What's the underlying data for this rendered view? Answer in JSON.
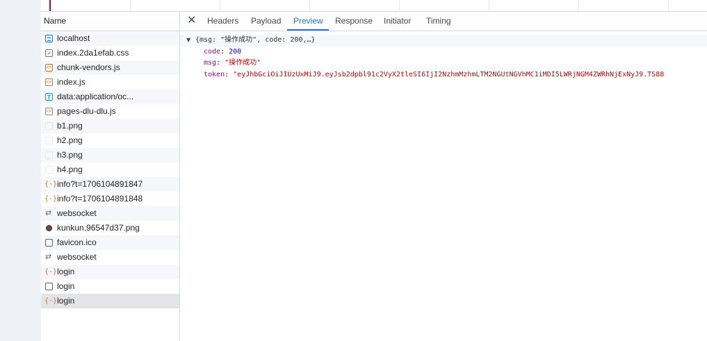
{
  "name_header": "Name",
  "requests": [
    {
      "icon": "document-icon",
      "type": "doc",
      "name": "localhost"
    },
    {
      "icon": "stylesheet-icon",
      "type": "css",
      "name": "index.2da1efab.css"
    },
    {
      "icon": "script-icon",
      "type": "js",
      "name": "chunk-vendors.js"
    },
    {
      "icon": "script-icon",
      "type": "js",
      "name": "index.js"
    },
    {
      "icon": "data-uri-icon",
      "type": "data",
      "name": "data:application/oc..."
    },
    {
      "icon": "script-icon",
      "type": "js",
      "name": "pages-dlu-dlu.js"
    },
    {
      "icon": "image-icon",
      "type": "img",
      "name": "b1.png"
    },
    {
      "icon": "image-icon",
      "type": "img",
      "name": "h2.png"
    },
    {
      "icon": "image-icon",
      "type": "img",
      "name": "h3.png"
    },
    {
      "icon": "image-icon",
      "type": "img",
      "name": "h4.png"
    },
    {
      "icon": "xhr-icon",
      "type": "xhr",
      "name": "info?t=1706104891847"
    },
    {
      "icon": "xhr-icon",
      "type": "xhr",
      "name": "info?t=1706104891848"
    },
    {
      "icon": "websocket-icon",
      "type": "ws",
      "name": "websocket"
    },
    {
      "icon": "image-thumbnail-icon",
      "type": "png",
      "name": "kunkun.96547d37.png"
    },
    {
      "icon": "blank-document-icon",
      "type": "blank",
      "name": "favicon.ico"
    },
    {
      "icon": "websocket-icon",
      "type": "ws",
      "name": "websocket"
    },
    {
      "icon": "xhr-icon",
      "type": "xhr",
      "name": "login"
    },
    {
      "icon": "blank-document-icon",
      "type": "blank",
      "name": "login"
    },
    {
      "icon": "xhr-icon",
      "type": "xhr",
      "name": "login"
    }
  ],
  "selected_index": 18,
  "tabs": [
    "Headers",
    "Payload",
    "Preview",
    "Response",
    "Initiator",
    "Timing"
  ],
  "active_tab": "Preview",
  "preview": {
    "summary": "{msg: \"操作成功\", code: 200,…}",
    "fields": [
      {
        "key": "code",
        "value": "200",
        "kind": "number"
      },
      {
        "key": "msg",
        "value": "\"操作成功\"",
        "kind": "string"
      },
      {
        "key": "token",
        "value": "\"eyJhbGciOiJIUzUxMiJ9.eyJsb2dpbl91c2VyX2tleSI6IjI2NzhmMzhmLTM2NGUtNGVhMC1iMDI5LWRjNGM4ZWRhNjExNyJ9.TS88",
        "kind": "string"
      }
    ]
  },
  "colors": {
    "accent": "#1a73e8",
    "json_key": "#881280",
    "json_string": "#c80000",
    "json_number": "#1c00cf"
  }
}
